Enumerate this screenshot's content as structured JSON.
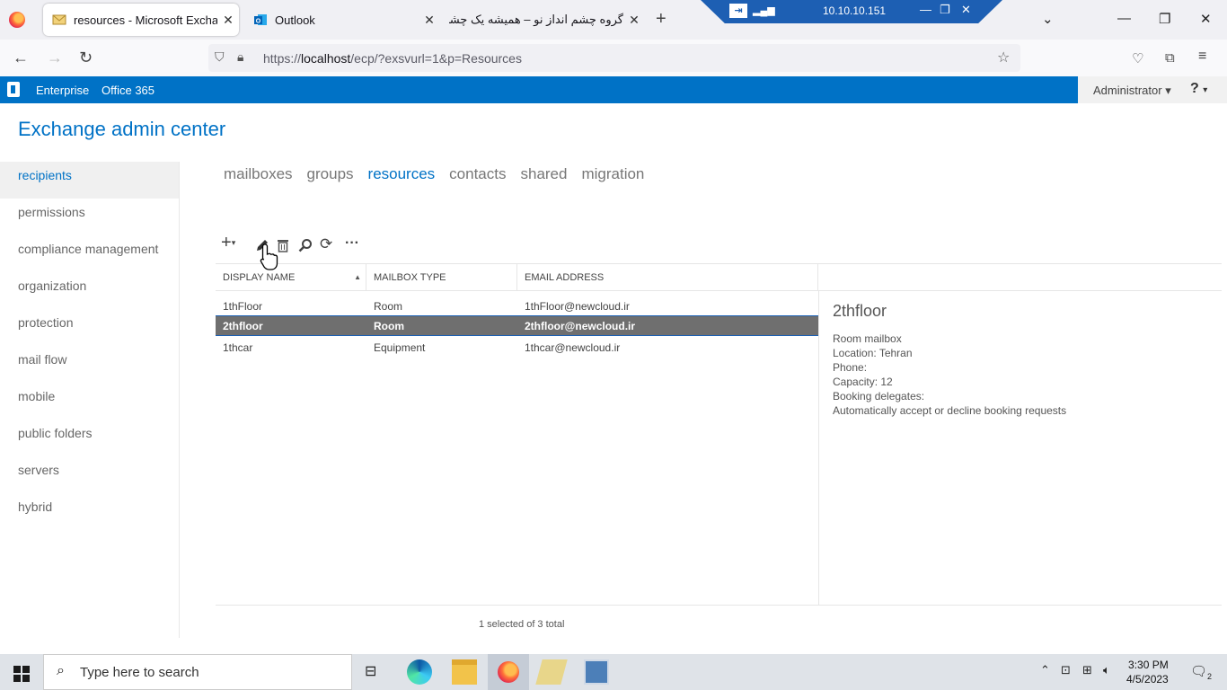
{
  "browser": {
    "tabs": [
      {
        "title": "resources - Microsoft Exchange",
        "active": true
      },
      {
        "title": "Outlook",
        "active": false
      },
      {
        "title": "گروه چشم انداز نو – همیشه یک چشم",
        "active": false
      }
    ],
    "rdp_host": "10.10.10.151",
    "url_prefix": "https://",
    "url_host": "localhost",
    "url_path": "/ecp/?exsvurl=1&p=Resources"
  },
  "header": {
    "enterprise": "Enterprise",
    "office365": "Office 365",
    "user": "Administrator",
    "help": "?"
  },
  "app_title": "Exchange admin center",
  "left_nav": [
    {
      "label": "recipients",
      "selected": true
    },
    {
      "label": "permissions"
    },
    {
      "label": "compliance management"
    },
    {
      "label": "organization"
    },
    {
      "label": "protection"
    },
    {
      "label": "mail flow"
    },
    {
      "label": "mobile"
    },
    {
      "label": "public folders"
    },
    {
      "label": "servers"
    },
    {
      "label": "hybrid"
    }
  ],
  "sub_tabs": [
    {
      "label": "mailboxes"
    },
    {
      "label": "groups"
    },
    {
      "label": "resources",
      "selected": true
    },
    {
      "label": "contacts"
    },
    {
      "label": "shared"
    },
    {
      "label": "migration"
    }
  ],
  "grid": {
    "columns": [
      "DISPLAY NAME",
      "MAILBOX TYPE",
      "EMAIL ADDRESS"
    ],
    "rows": [
      {
        "name": "1thFloor",
        "type": "Room",
        "email": "1thFloor@newcloud.ir",
        "selected": false
      },
      {
        "name": "2thfloor",
        "type": "Room",
        "email": "2thfloor@newcloud.ir",
        "selected": true
      },
      {
        "name": "1thcar",
        "type": "Equipment",
        "email": "1thcar@newcloud.ir",
        "selected": false
      }
    ],
    "status": "1 selected of 3 total"
  },
  "details": {
    "title": "2thfloor",
    "lines": [
      "Room mailbox",
      "Location: Tehran",
      "Phone:",
      "Capacity: 12",
      "Booking delegates:",
      "Automatically accept or decline booking requests"
    ]
  },
  "taskbar": {
    "search_placeholder": "Type here to search",
    "time": "3:30 PM",
    "date": "4/5/2023",
    "notifications": "2"
  }
}
